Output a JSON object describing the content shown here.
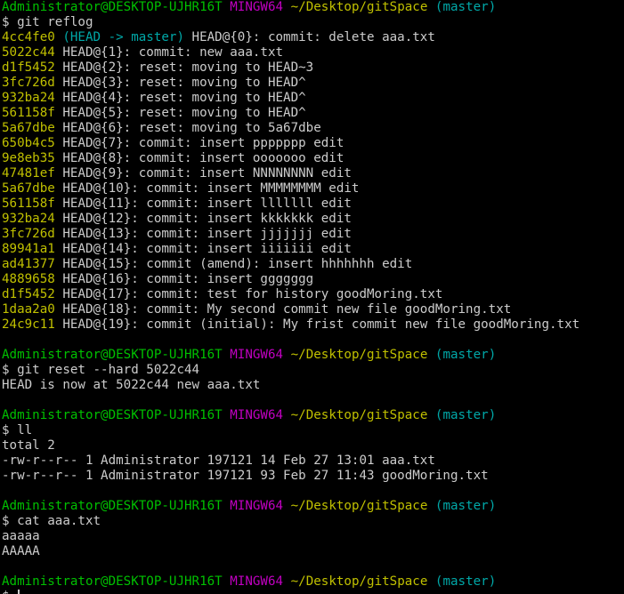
{
  "colors": {
    "background": "#000000",
    "text": "#cccccc",
    "user_host": "#00c000",
    "msystem": "#c000c0",
    "path": "#c0c000",
    "branch": "#00a8a8"
  },
  "prompts": [
    {
      "user_host": "Administrator@DESKTOP-UJHR16T",
      "msystem": "MINGW64",
      "path": "~/Desktop/gitSpace",
      "branch": "(master)"
    },
    {
      "user_host": "Administrator@DESKTOP-UJHR16T",
      "msystem": "MINGW64",
      "path": "~/Desktop/gitSpace",
      "branch": "(master)"
    },
    {
      "user_host": "Administrator@DESKTOP-UJHR16T",
      "msystem": "MINGW64",
      "path": "~/Desktop/gitSpace",
      "branch": "(master)"
    },
    {
      "user_host": "Administrator@DESKTOP-UJHR16T",
      "msystem": "MINGW64",
      "path": "~/Desktop/gitSpace",
      "branch": "(master)"
    },
    {
      "user_host": "Administrator@DESKTOP-UJHR16T",
      "msystem": "MINGW64",
      "path": "~/Desktop/gitSpace",
      "branch": "(master)"
    }
  ],
  "commands": [
    "$ git reflog",
    "$ git reset --hard 5022c44",
    "$ ll",
    "$ cat aaa.txt",
    "$ "
  ],
  "reflog_head": {
    "hash": "4cc4fe0",
    "ref": "(HEAD -> master)",
    "text": " HEAD@{0}: commit: delete aaa.txt"
  },
  "reflog_entries": [
    {
      "hash": "5022c44",
      "text": " HEAD@{1}: commit: new aaa.txt"
    },
    {
      "hash": "d1f5452",
      "text": " HEAD@{2}: reset: moving to HEAD~3"
    },
    {
      "hash": "3fc726d",
      "text": " HEAD@{3}: reset: moving to HEAD^"
    },
    {
      "hash": "932ba24",
      "text": " HEAD@{4}: reset: moving to HEAD^"
    },
    {
      "hash": "561158f",
      "text": " HEAD@{5}: reset: moving to HEAD^"
    },
    {
      "hash": "5a67dbe",
      "text": " HEAD@{6}: reset: moving to 5a67dbe"
    },
    {
      "hash": "650b4c5",
      "text": " HEAD@{7}: commit: insert ppppppp edit"
    },
    {
      "hash": "9e8eb35",
      "text": " HEAD@{8}: commit: insert ooooooo edit"
    },
    {
      "hash": "47481ef",
      "text": " HEAD@{9}: commit: insert NNNNNNNN edit"
    },
    {
      "hash": "5a67dbe",
      "text": " HEAD@{10}: commit: insert MMMMMMMM edit"
    },
    {
      "hash": "561158f",
      "text": " HEAD@{11}: commit: insert lllllll edit"
    },
    {
      "hash": "932ba24",
      "text": " HEAD@{12}: commit: insert kkkkkkk edit"
    },
    {
      "hash": "3fc726d",
      "text": " HEAD@{13}: commit: insert jjjjjjj edit"
    },
    {
      "hash": "89941a1",
      "text": " HEAD@{14}: commit: insert iiiiiii edit"
    },
    {
      "hash": "ad41377",
      "text": " HEAD@{15}: commit (amend): insert hhhhhhh edit"
    },
    {
      "hash": "4889658",
      "text": " HEAD@{16}: commit: insert ggggggg"
    },
    {
      "hash": "d1f5452",
      "text": " HEAD@{17}: commit: test for history goodMoring.txt"
    },
    {
      "hash": "1daa2a0",
      "text": " HEAD@{18}: commit: My second commit new file goodMoring.txt"
    },
    {
      "hash": "24c9c11",
      "text": " HEAD@{19}: commit (initial): My frist commit new file goodMoring.txt"
    }
  ],
  "reset_output": "HEAD is now at 5022c44 new aaa.txt",
  "ll_output": [
    "total 2",
    "-rw-r--r-- 1 Administrator 197121 14 Feb 27 13:01 aaa.txt",
    "-rw-r--r-- 1 Administrator 197121 93 Feb 27 11:43 goodMoring.txt"
  ],
  "cat_output": [
    "aaaaa",
    "AAAAA"
  ]
}
